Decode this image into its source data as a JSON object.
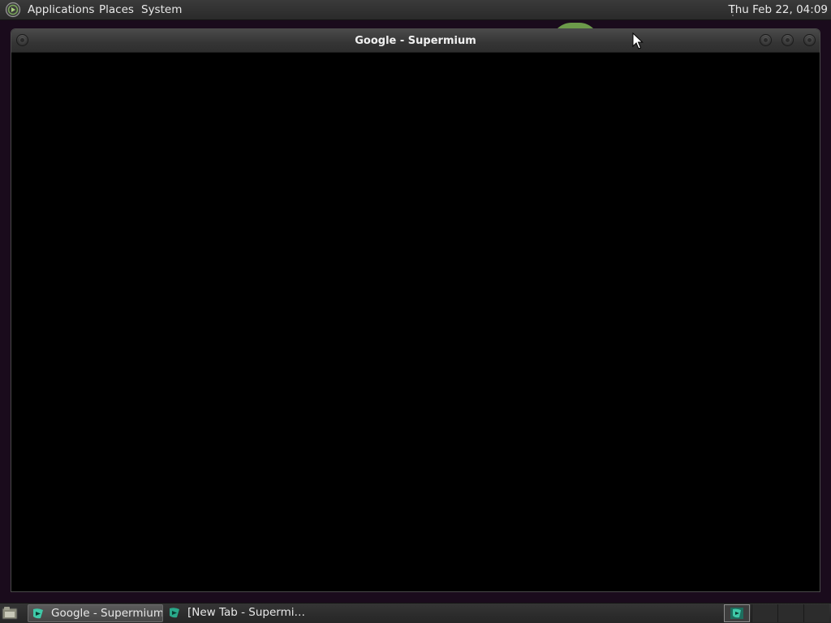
{
  "top_panel": {
    "menus": {
      "applications": "Applications",
      "places": "Places",
      "system": "System"
    },
    "clock": "Thu Feb 22, 04:09"
  },
  "window": {
    "title": "Google - Supermium"
  },
  "taskbar": {
    "tasks": [
      {
        "label": "Google - Supermium",
        "active": true
      },
      {
        "label": "[New Tab - Supermi…",
        "active": false
      }
    ],
    "workspaces": 4,
    "active_workspace": 1
  },
  "icons": {
    "menu_logo": "menu-logo-icon",
    "show_desktop": "show-desktop-icon",
    "browser": "supermium-icon"
  },
  "colors": {
    "panel": "#2e2e2e",
    "desktop": "#1a0b1c",
    "window_content": "#000000",
    "icon_accent": "#3fc9a8"
  }
}
